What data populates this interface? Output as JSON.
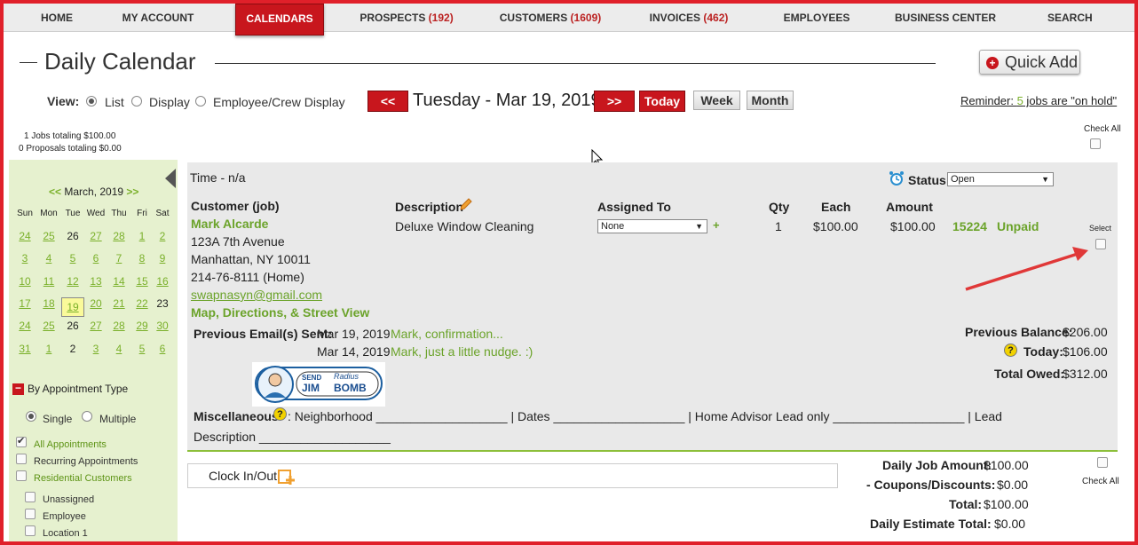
{
  "nav": {
    "items": [
      {
        "label": "HOME"
      },
      {
        "label": "MY ACCOUNT"
      },
      {
        "label": "CALENDARS"
      },
      {
        "label": "PROSPECTS",
        "count": "(192)"
      },
      {
        "label": "CUSTOMERS",
        "count": "(1609)"
      },
      {
        "label": "INVOICES",
        "count": "(462)"
      },
      {
        "label": "EMPLOYEES"
      },
      {
        "label": "BUSINESS CENTER"
      },
      {
        "label": "SEARCH"
      }
    ]
  },
  "page": {
    "title": "Daily Calendar",
    "quick_add": "Quick Add",
    "quick_add_icon": "plus-circle-icon"
  },
  "view": {
    "label": "View:",
    "options": [
      "List",
      "Display",
      "Employee/Crew Display"
    ],
    "selected": "List"
  },
  "date_nav": {
    "prev": "<<",
    "date": "Tuesday - Mar 19, 2019",
    "next": ">>",
    "today": "Today",
    "week": "Week",
    "month": "Month"
  },
  "reminder": {
    "prefix": "Reminder: ",
    "count": "5",
    "suffix": " jobs are \"on hold\""
  },
  "summary": {
    "jobs": "1 Jobs totaling $100.00",
    "proposals": "0 Proposals totaling $0.00"
  },
  "check_all": "Check All",
  "mini_calendar": {
    "prev": "<<",
    "month": "March, 2019",
    "next": ">>",
    "dow": [
      "Sun",
      "Mon",
      "Tue",
      "Wed",
      "Thu",
      "Fri",
      "Sat"
    ],
    "weeks": [
      [
        "24",
        "25",
        "26",
        "27",
        "28",
        "1",
        "2"
      ],
      [
        "3",
        "4",
        "5",
        "6",
        "7",
        "8",
        "9"
      ],
      [
        "10",
        "11",
        "12",
        "13",
        "14",
        "15",
        "16"
      ],
      [
        "17",
        "18",
        "19",
        "20",
        "21",
        "22",
        "23"
      ],
      [
        "24",
        "25",
        "26",
        "27",
        "28",
        "29",
        "30"
      ],
      [
        "31",
        "1",
        "2",
        "3",
        "4",
        "5",
        "6"
      ]
    ],
    "selected_day": "19"
  },
  "filters": {
    "title": "By Appointment Type",
    "mode_options": [
      "Single",
      "Multiple"
    ],
    "mode_selected": "Single",
    "appointments": [
      {
        "label": "All Appointments",
        "checked": true
      },
      {
        "label": "Recurring Appointments",
        "checked": false
      },
      {
        "label": "Residential Customers",
        "checked": false
      }
    ],
    "employees": [
      {
        "label": "Unassigned",
        "checked": false
      },
      {
        "label": "Employee",
        "checked": false
      },
      {
        "label": "Location 1",
        "checked": false
      }
    ]
  },
  "job": {
    "time": "Time - n/a",
    "status_label": "Status:",
    "status_value": "Open",
    "customer_header": "Customer (job)",
    "customer_name": "Mark Alcarde",
    "address1": "123A 7th Avenue",
    "address2": "Manhattan, NY 10011",
    "phone": "214-76-8111 (Home)",
    "email": "swapnasyn@gmail.com",
    "map_link": "Map, Directions, & Street View",
    "description_header": "Description",
    "description": "Deluxe Window Cleaning",
    "assigned_header": "Assigned To",
    "assigned_value": "None",
    "assigned_add": "+",
    "qty_header": "Qty",
    "qty": "1",
    "each_header": "Each",
    "each": "$100.00",
    "amount_header": "Amount",
    "amount": "$100.00",
    "job_number": "15224",
    "payment_status": "Unpaid",
    "select_label": "Select",
    "emails_label": "Previous Email(s) Sent:",
    "emails": [
      {
        "date": "Mar 19, 2019",
        "subject": "Mark, confirmation..."
      },
      {
        "date": "Mar 14, 2019",
        "subject": "Mark, just a little nudge. :)"
      }
    ],
    "logo_text_top": "SEND",
    "logo_text_name": "JIM",
    "logo_text_radius": "Radius",
    "logo_text_bomb": "BOMB",
    "previous_balance_label": "Previous Balance:",
    "previous_balance": "$206.00",
    "today_label": "Today:",
    "today": "$106.00",
    "total_owed_label": "Total Owed:",
    "total_owed": "$312.00",
    "misc_label": "Miscellaneous",
    "misc_text": ": Neighborhood ___________________ | Dates ___________________ | Home Advisor Lead only ___________________ | Lead",
    "misc_text2": "Description ___________________"
  },
  "footer": {
    "clock": "Clock In/Out",
    "daily_job_amount_label": "Daily Job Amount:",
    "daily_job_amount": "$100.00",
    "coupons_label": "- Coupons/Discounts:",
    "coupons": "$0.00",
    "total_label": "Total:",
    "total": "$100.00",
    "estimate_label": "Daily Estimate Total:",
    "estimate": "$0.00",
    "check_all": "Check All"
  },
  "colors": {
    "accent_red": "#c8161d",
    "link_green": "#6ba32a",
    "sidebar_bg": "#e6f1cf"
  }
}
